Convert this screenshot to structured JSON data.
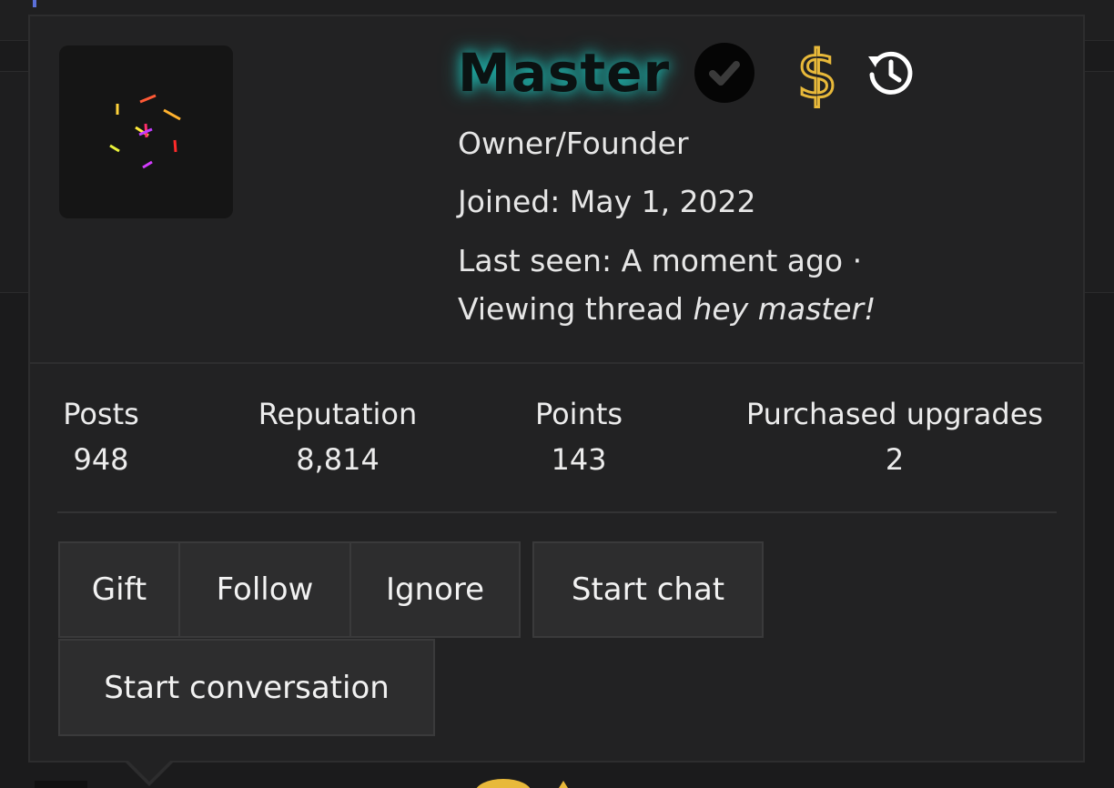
{
  "profile": {
    "username": "Master",
    "title": "Owner/Founder",
    "joined_label": "Joined:",
    "joined_date": "May 1, 2022",
    "last_seen_label": "Last seen:",
    "last_seen_value": "A moment ago ·",
    "activity_prefix": "Viewing thread",
    "activity_thread": "hey master!",
    "name_glow_color": "#1fb5ad",
    "icons": [
      "avatar-image",
      "verified-check-icon",
      "dollar-icon",
      "history-icon"
    ]
  },
  "stats": [
    {
      "label": "Posts",
      "value": "948"
    },
    {
      "label": "Reputation",
      "value": "8,814"
    },
    {
      "label": "Points",
      "value": "143"
    },
    {
      "label": "Purchased upgrades",
      "value": "2"
    }
  ],
  "actions": {
    "gift": "Gift",
    "follow": "Follow",
    "ignore": "Ignore",
    "start_chat": "Start chat",
    "start_conversation": "Start conversation"
  },
  "colors": {
    "card_bg": "#222223",
    "button_bg": "#2d2d2e",
    "dollar_gold": "#e8b93a"
  }
}
